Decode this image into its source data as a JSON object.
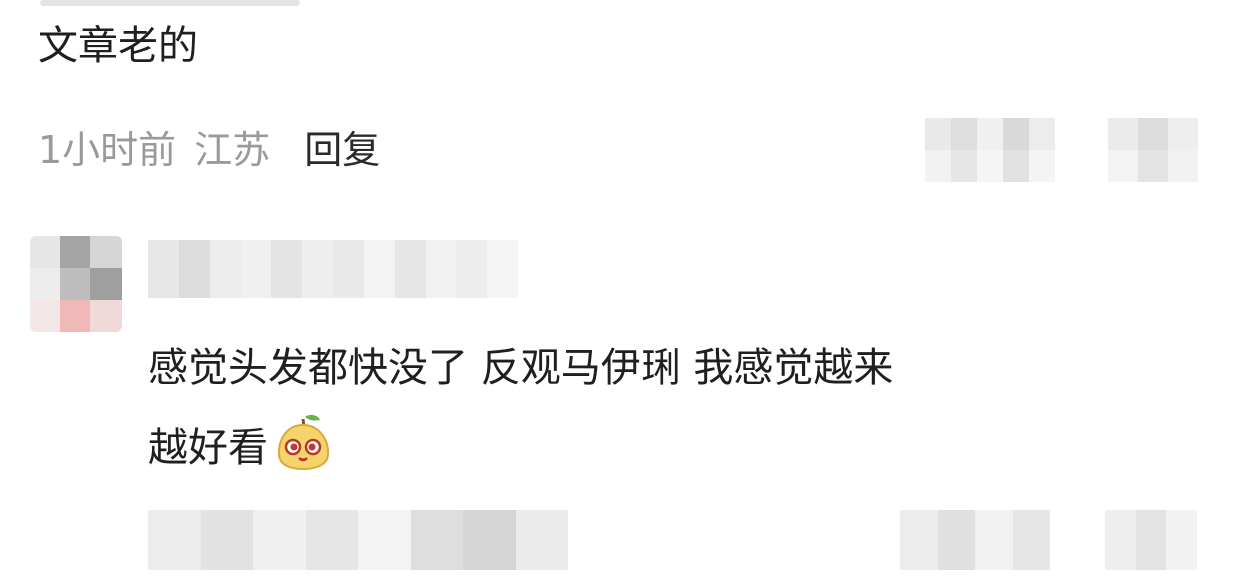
{
  "comment": {
    "text": "文章老的",
    "time": "1小时前",
    "location": "江苏",
    "reply_label": "回复"
  },
  "reply": {
    "text_line1": "感觉头发都快没了 反观马伊琍 我感觉越来",
    "text_line2": "越好看",
    "emoji": "pear-face-emoji"
  }
}
